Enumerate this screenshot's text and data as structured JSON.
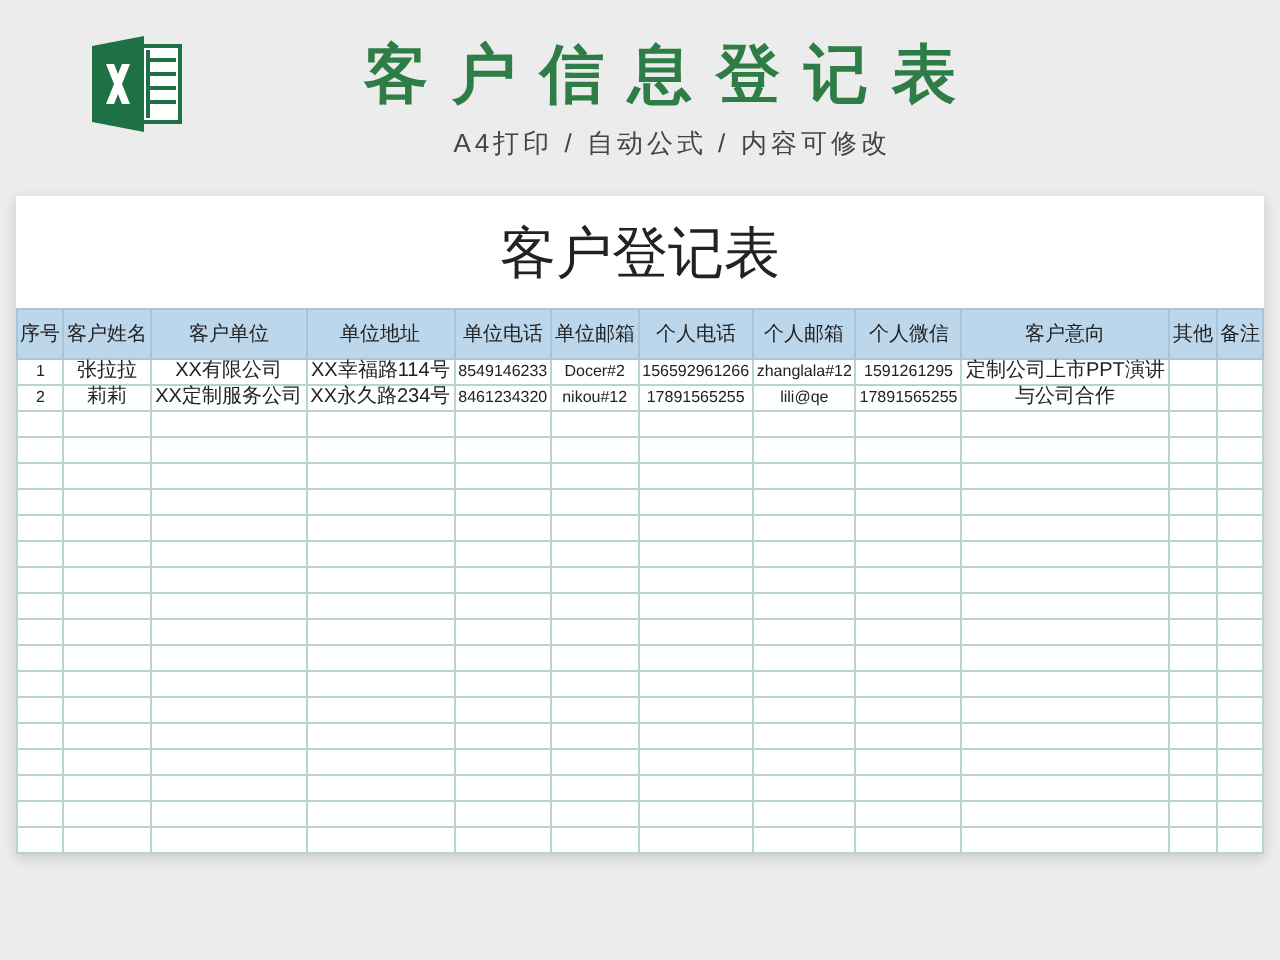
{
  "banner": {
    "title": "客户信息登记表",
    "subtitle": "A4打印 / 自动公式 / 内容可修改"
  },
  "sheet": {
    "title": "客户登记表",
    "columns": [
      "序号",
      "客户姓名",
      "客户单位",
      "单位地址",
      "单位电话",
      "单位邮箱",
      "个人电话",
      "个人邮箱",
      "个人微信",
      "客户意向",
      "其他",
      "备注"
    ],
    "rows": [
      {
        "cells": [
          "1",
          "张拉拉",
          "XX有限公司",
          "XX幸福路114号",
          "8549146233",
          "Docer#2",
          "156592961266",
          "zhanglala#12",
          "1591261295",
          "定制公司上市PPT演讲",
          "",
          ""
        ]
      },
      {
        "cells": [
          "2",
          "莉莉",
          "XX定制服务公司",
          "XX永久路234号",
          "8461234320",
          "nikou#12",
          "17891565255",
          "lili@qe",
          "17891565255",
          "与公司合作",
          "",
          ""
        ]
      }
    ]
  }
}
